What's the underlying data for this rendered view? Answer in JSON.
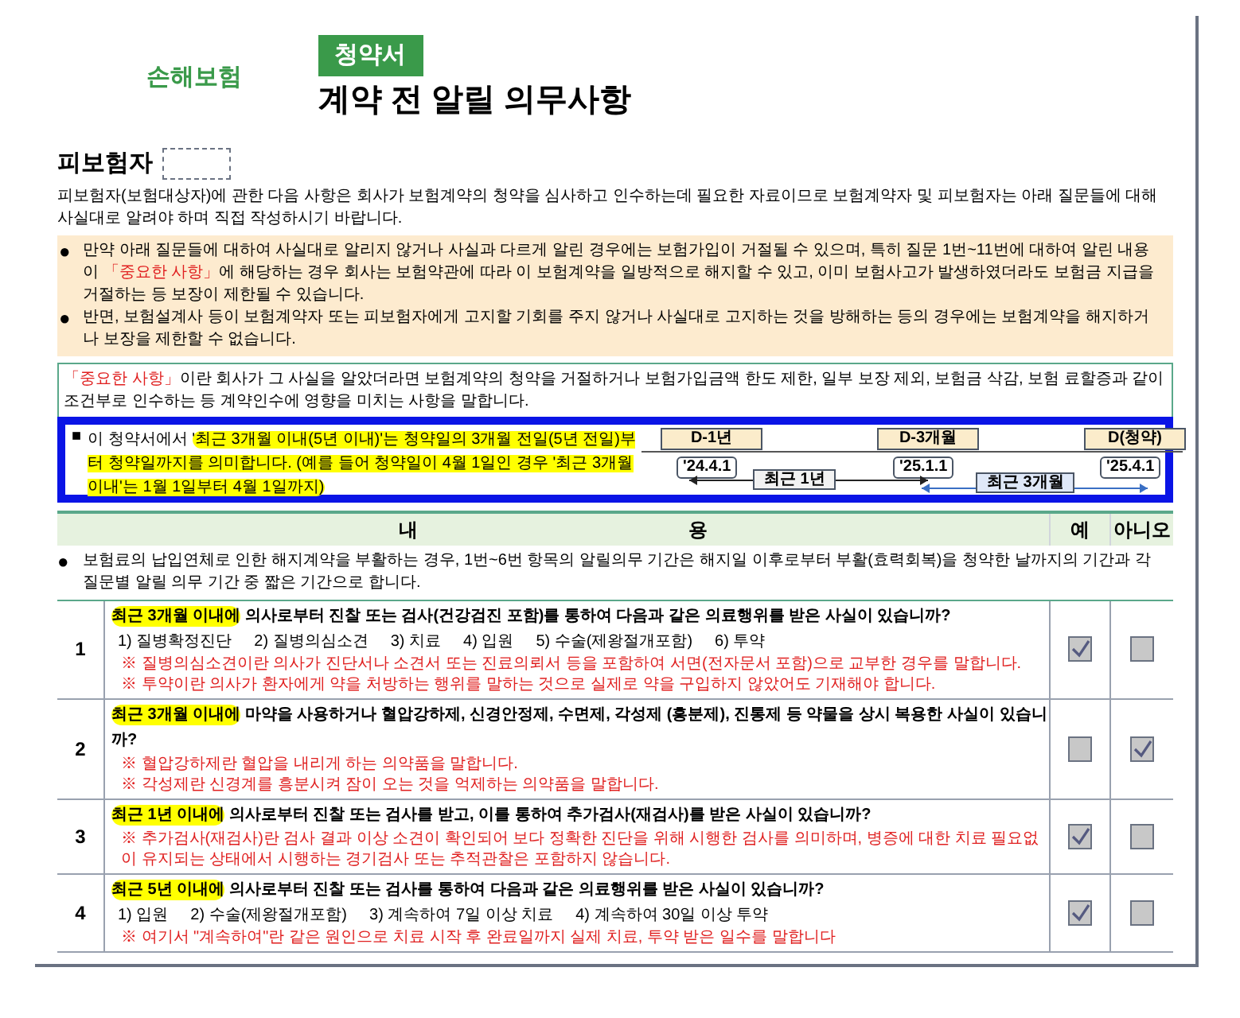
{
  "header": {
    "company": "손해보험",
    "tab": "청약서",
    "title": "계약 전 알릴 의무사항"
  },
  "insured": {
    "label": "피보험자",
    "intro": "피보험자(보험대상자)에 관한 다음 사항은 회사가 보험계약의 청약을 심사하고 인수하는데 필요한 자료이므로 보험계약자 및 피보험자는 아래 질문들에 대해 사실대로 알려야 하며 직접 작성하시기 바랍니다."
  },
  "warnings": [
    [
      {
        "kind": "plain",
        "text": "만약 아래 질문들에 대하여 사실대로 알리지 않거나 사실과 다르게 알린 경우에는 보험가입이 거절될 수 있으며, 특히 질문 1번~11번에 대하여 알린 내용이 "
      },
      {
        "kind": "red",
        "text": "「중요한 사항」"
      },
      {
        "kind": "plain",
        "text": "에 해당하는 경우 회사는 보험약관에 따라 이 보험계약을 일방적으로 해지할 수 있고, 이미 보험사고가 발생하였더라도 보험금 지급을 거절하는 등 보장이 제한될 수 있습니다."
      }
    ],
    [
      {
        "kind": "plain",
        "text": "반면, 보험설계사 등이 보험계약자 또는 피보험자에게 고지할 기회를 주지 않거나 사실대로 고지하는 것을 방해하는 등의 경우에는 보험계약을 해지하거나 보장을 제한할 수 없습니다."
      }
    ]
  ],
  "definition": [
    {
      "kind": "red",
      "text": "「중요한 사항」"
    },
    {
      "kind": "plain",
      "text": "이란 회사가 그 사실을 알았더라면 보험계약의 청약을 거절하거나 보험가입금액 한도 제한, 일부 보장 제외, 보험금 삭감, 보험 료할증과 같이 조건부로 인수하는 등 계약인수에 영향을 미치는 사항을 말합니다."
    }
  ],
  "period_note": {
    "marker": "■",
    "segments": [
      {
        "kind": "plain",
        "text": "이 청약서에서 "
      },
      {
        "kind": "highlight",
        "text": "'최근 3개월 이내(5년 이내)'는 청약일의 3개월 전일(5년 전일)부터 청약일까지를 의미합니다. (예를 들어 청약일이 4월 1일인 경우 '최근 3개월 이내'는 1월 1일부터 4월 1일까지)"
      }
    ]
  },
  "timeline": {
    "points": [
      {
        "label": "D-1년",
        "date": "'24.4.1"
      },
      {
        "label": "D-3개월",
        "date": "'25.1.1"
      },
      {
        "label": "D(청약)",
        "date": "'25.4.1"
      }
    ],
    "spans": [
      "최근 1년",
      "최근 3개월"
    ]
  },
  "table": {
    "columns": [
      "내",
      "용",
      "예",
      "아니오"
    ],
    "note": {
      "bullet": "●",
      "text": "보험료의 납입연체로 인한 해지계약을 부활하는 경우, 1번~6번 항목의 알릴의무 기간은 해지일 이후로부터 부활(효력회복)을 청약한 날까지의 기간과 각 질문별 알릴 의무 기간 중 짧은 기간으로 합니다."
    },
    "questions": [
      {
        "number": "1",
        "period": "최근 3개월 이내에",
        "text": " 의사로부터 진찰 또는 검사(건강검진 포함)를 통하여 다음과 같은 의료행위를 받은 사실이 있습니까?",
        "options": [
          "1) 질병확정진단",
          "2) 질병의심소견",
          "3) 치료",
          "4) 입원",
          "5) 수술(제왕절개포함)",
          "6) 투약"
        ],
        "notes": [
          "※ 질병의심소견이란 의사가 진단서나 소견서 또는 진료의뢰서 등을 포함하여 서면(전자문서 포함)으로 교부한 경우를 말합니다.",
          "※ 투약이란 의사가 환자에게 약을 처방하는 행위를 말하는 것으로 실제로 약을 구입하지 않았어도 기재해야 합니다."
        ],
        "yes": true,
        "no": false
      },
      {
        "number": "2",
        "period": "최근 3개월 이내에",
        "text": " 마약을 사용하거나 혈압강하제, 신경안정제, 수면제, 각성제 (흥분제), 진통제 등 약물을 상시 복용한 사실이 있습니까?",
        "notes": [
          "※ 혈압강하제란 혈압을 내리게 하는 의약품을 말합니다.",
          "※ 각성제란 신경계를 흥분시켜 잠이 오는 것을 억제하는 의약품을 말합니다."
        ],
        "yes": false,
        "no": true
      },
      {
        "number": "3",
        "period": "최근 1년 이내에",
        "text": " 의사로부터 진찰 또는 검사를 받고, 이를 통하여 추가검사(재검사)를 받은 사실이 있습니까?",
        "notes": [
          "※ 추가검사(재검사)란 검사 결과 이상 소견이 확인되어 보다 정확한 진단을 위해 시행한 검사를 의미하며, 병증에 대한 치료 필요없이 유지되는 상태에서 시행하는 경기검사 또는 추적관찰은 포함하지 않습니다."
        ],
        "yes": true,
        "no": false
      },
      {
        "number": "4",
        "period": "최근 5년 이내에",
        "text": " 의사로부터 진찰 또는 검사를 통하여 다음과 같은 의료행위를 받은 사실이 있습니까?",
        "options": [
          "1) 입원",
          "2) 수술(제왕절개포함)",
          "3) 계속하여 7일 이상 치료",
          "4) 계속하여 30일 이상 투약"
        ],
        "notes": [
          "※ 여기서 \"계속하여\"란 같은 원인으로 치료 시작 후 완료일까지 실제 치료, 투약 받은 일수를 말합니다"
        ],
        "yes": true,
        "no": false
      }
    ]
  }
}
